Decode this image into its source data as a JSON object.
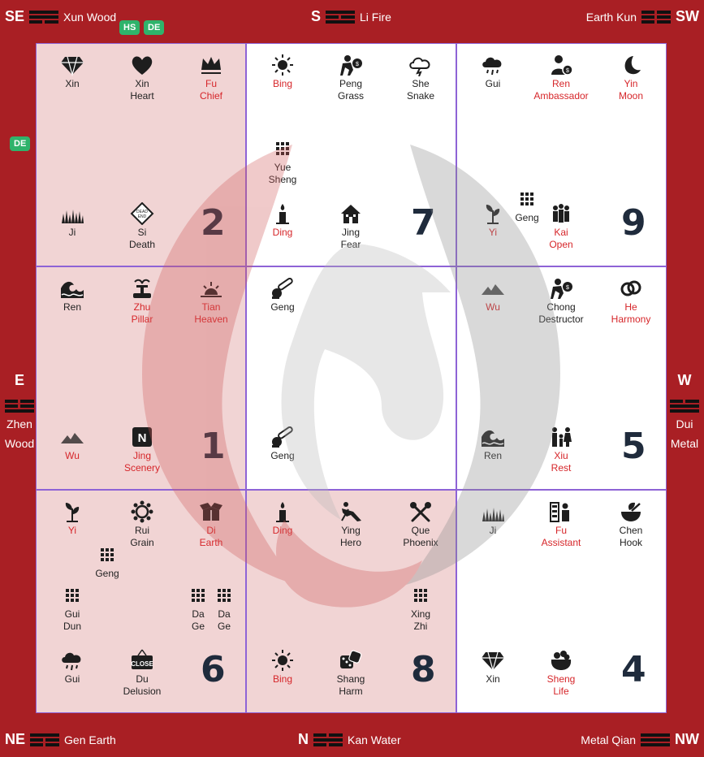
{
  "directions": {
    "se": {
      "abbr": "SE",
      "label": "Xun Wood"
    },
    "s": {
      "abbr": "S",
      "label": "Li Fire"
    },
    "sw": {
      "abbr": "SW",
      "label": "Earth Kun"
    },
    "e": {
      "abbr": "E",
      "label1": "Zhen",
      "label2": "Wood"
    },
    "w": {
      "abbr": "W",
      "label1": "Dui",
      "label2": "Metal"
    },
    "ne": {
      "abbr": "NE",
      "label": "Gen Earth"
    },
    "n": {
      "abbr": "N",
      "label": "Kan Water"
    },
    "nw": {
      "abbr": "NW",
      "label": "Metal Qian"
    }
  },
  "badges": {
    "hs": "HS",
    "de_top": "DE",
    "de_left": "DE"
  },
  "colors": {
    "frame": "#a91f24",
    "accent_red": "#d6262a",
    "badge_green": "#2fb36b",
    "grid_line": "#8e63d6",
    "shade": "#f1d4d4"
  },
  "palaces": [
    {
      "number": "2",
      "items": [
        {
          "icon": "diamond-icon",
          "l1": "Xin",
          "l2": "",
          "red": false
        },
        {
          "icon": "heart-icon",
          "l1": "Xin",
          "l2": "Heart",
          "red": false
        },
        {
          "icon": "crown-icon",
          "l1": "Fu",
          "l2": "Chief",
          "red": true
        },
        {
          "icon": "grass-icon",
          "l1": "Ji",
          "l2": "",
          "red": false
        },
        {
          "icon": "dead-end-sign-icon",
          "l1": "Si",
          "l2": "Death",
          "red": false
        }
      ]
    },
    {
      "number": "7",
      "items": [
        {
          "icon": "sun-icon",
          "l1": "Bing",
          "l2": "",
          "red": true
        },
        {
          "icon": "thief-icon",
          "l1": "Peng",
          "l2": "Grass",
          "red": false
        },
        {
          "icon": "storm-cloud-icon",
          "l1": "She",
          "l2": "Snake",
          "red": false
        },
        {
          "icon": "grid-icon",
          "l1": "Yue",
          "l2": "Sheng",
          "red": false
        },
        {
          "icon": "candle-icon",
          "l1": "Ding",
          "l2": "",
          "red": true
        },
        {
          "icon": "haunted-house-icon",
          "l1": "Jing",
          "l2": "Fear",
          "red": false
        }
      ]
    },
    {
      "number": "9",
      "items": [
        {
          "icon": "rain-cloud-icon",
          "l1": "Gui",
          "l2": "",
          "red": false
        },
        {
          "icon": "businessman-icon",
          "l1": "Ren",
          "l2": "Ambassador",
          "red": true
        },
        {
          "icon": "moon-icon",
          "l1": "Yin",
          "l2": "Moon",
          "red": true
        },
        {
          "icon": "grid-icon",
          "l1": "Geng",
          "l2": "",
          "red": false
        },
        {
          "icon": "sprout-icon",
          "l1": "Yi",
          "l2": "",
          "red": true
        },
        {
          "icon": "people-group-icon",
          "l1": "Kai",
          "l2": "Open",
          "red": true
        }
      ]
    },
    {
      "number": "1",
      "items": [
        {
          "icon": "wave-icon",
          "l1": "Ren",
          "l2": "",
          "red": false
        },
        {
          "icon": "fountain-icon",
          "l1": "Zhu",
          "l2": "Pillar",
          "red": true
        },
        {
          "icon": "sunrise-icon",
          "l1": "Tian",
          "l2": "Heaven",
          "red": true
        },
        {
          "icon": "mountain-icon",
          "l1": "Wu",
          "l2": "",
          "red": true
        },
        {
          "icon": "n-badge-icon",
          "l1": "Jing",
          "l2": "Scenery",
          "red": true
        }
      ]
    },
    {
      "number": "",
      "items": [
        {
          "icon": "chainsaw-icon",
          "l1": "Geng",
          "l2": "",
          "red": false
        },
        {
          "icon": "chainsaw-icon",
          "l1": "Geng",
          "l2": "",
          "red": false
        }
      ]
    },
    {
      "number": "5",
      "items": [
        {
          "icon": "mountain-icon",
          "l1": "Wu",
          "l2": "",
          "red": true
        },
        {
          "icon": "thief-icon",
          "l1": "Chong",
          "l2": "Destructor",
          "red": false
        },
        {
          "icon": "rings-icon",
          "l1": "He",
          "l2": "Harmony",
          "red": true
        },
        {
          "icon": "wave-icon",
          "l1": "Ren",
          "l2": "",
          "red": false
        },
        {
          "icon": "family-icon",
          "l1": "Xiu",
          "l2": "Rest",
          "red": true
        }
      ]
    },
    {
      "number": "6",
      "items": [
        {
          "icon": "sprout-icon",
          "l1": "Yi",
          "l2": "",
          "red": true
        },
        {
          "icon": "virus-icon",
          "l1": "Rui",
          "l2": "Grain",
          "red": false
        },
        {
          "icon": "box-icon",
          "l1": "Di",
          "l2": "Earth",
          "red": true
        },
        {
          "icon": "grid-icon",
          "l1": "Geng",
          "l2": "",
          "red": false
        },
        {
          "icon": "grid-icon",
          "l1": "Gui",
          "l2": "Dun",
          "red": false
        },
        {
          "icon": "grid-icon",
          "l1": "Da",
          "l2": "Ge",
          "red": false
        },
        {
          "icon": "grid-icon",
          "l1": "Da",
          "l2": "Ge",
          "red": false
        },
        {
          "icon": "rain-cloud-icon",
          "l1": "Gui",
          "l2": "",
          "red": false
        },
        {
          "icon": "close-sign-icon",
          "l1": "Du",
          "l2": "Delusion",
          "red": false
        }
      ]
    },
    {
      "number": "8",
      "items": [
        {
          "icon": "candle-icon",
          "l1": "Ding",
          "l2": "",
          "red": true
        },
        {
          "icon": "hero-icon",
          "l1": "Ying",
          "l2": "Hero",
          "red": false
        },
        {
          "icon": "crossed-tools-icon",
          "l1": "Que",
          "l2": "Phoenix",
          "red": false
        },
        {
          "icon": "grid-icon",
          "l1": "Xing",
          "l2": "Zhi",
          "red": false
        },
        {
          "icon": "sun-icon",
          "l1": "Bing",
          "l2": "",
          "red": true
        },
        {
          "icon": "dice-icon",
          "l1": "Shang",
          "l2": "Harm",
          "red": false
        }
      ]
    },
    {
      "number": "4",
      "items": [
        {
          "icon": "grass-icon",
          "l1": "Ji",
          "l2": "",
          "red": false
        },
        {
          "icon": "shopkeeper-icon",
          "l1": "Fu",
          "l2": "Assistant",
          "red": true
        },
        {
          "icon": "mortar-icon",
          "l1": "Chen",
          "l2": "Hook",
          "red": false
        },
        {
          "icon": "diamond-icon",
          "l1": "Xin",
          "l2": "",
          "red": false
        },
        {
          "icon": "money-pot-icon",
          "l1": "Sheng",
          "l2": "Life",
          "red": true
        }
      ]
    }
  ]
}
